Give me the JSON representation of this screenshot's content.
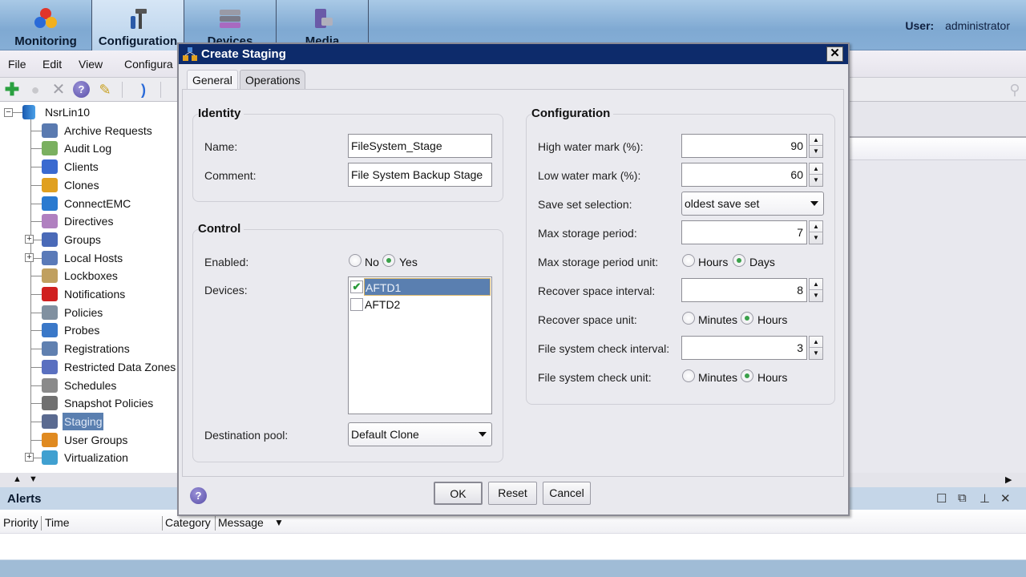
{
  "nav": {
    "tabs": [
      {
        "label": "Monitoring",
        "icon": "monitoring-icon",
        "active": false
      },
      {
        "label": "Configuration",
        "icon": "configuration-icon",
        "active": true
      },
      {
        "label": "Devices",
        "icon": "devices-icon",
        "active": false
      },
      {
        "label": "Media",
        "icon": "media-icon",
        "active": false
      }
    ],
    "user_label": "User:",
    "user_name": "administrator"
  },
  "menubar": [
    "File",
    "Edit",
    "View",
    "Configura"
  ],
  "toolbar": [
    "add-icon",
    "properties-icon",
    "delete-icon",
    "help-icon",
    "wizard-icon",
    "refresh-icon"
  ],
  "tree": {
    "root": "NsrLin10",
    "items": [
      {
        "label": "Archive Requests",
        "icon": "archive-requests-icon",
        "expandable": false
      },
      {
        "label": "Audit Log",
        "icon": "audit-log-icon",
        "expandable": false
      },
      {
        "label": "Clients",
        "icon": "clients-icon",
        "expandable": false
      },
      {
        "label": "Clones",
        "icon": "clones-icon",
        "expandable": false
      },
      {
        "label": "ConnectEMC",
        "icon": "connectemc-icon",
        "expandable": false
      },
      {
        "label": "Directives",
        "icon": "directives-icon",
        "expandable": false
      },
      {
        "label": "Groups",
        "icon": "groups-icon",
        "expandable": true
      },
      {
        "label": "Local Hosts",
        "icon": "local-hosts-icon",
        "expandable": true
      },
      {
        "label": "Lockboxes",
        "icon": "lockboxes-icon",
        "expandable": false
      },
      {
        "label": "Notifications",
        "icon": "notifications-icon",
        "expandable": false
      },
      {
        "label": "Policies",
        "icon": "policies-icon",
        "expandable": false
      },
      {
        "label": "Probes",
        "icon": "probes-icon",
        "expandable": false
      },
      {
        "label": "Registrations",
        "icon": "registrations-icon",
        "expandable": false
      },
      {
        "label": "Restricted Data Zones",
        "icon": "restricted-data-zones-icon",
        "expandable": false
      },
      {
        "label": "Schedules",
        "icon": "schedules-icon",
        "expandable": false
      },
      {
        "label": "Snapshot Policies",
        "icon": "snapshot-policies-icon",
        "expandable": false
      },
      {
        "label": "Staging",
        "icon": "staging-icon",
        "expandable": false,
        "selected": true
      },
      {
        "label": "User Groups",
        "icon": "user-groups-icon",
        "expandable": false
      },
      {
        "label": "Virtualization",
        "icon": "virtualization-icon",
        "expandable": true
      }
    ]
  },
  "alerts": {
    "title": "Alerts",
    "columns": [
      "Priority",
      "Time",
      "Category",
      "Message"
    ]
  },
  "dialog": {
    "title": "Create Staging",
    "tabs": [
      "General",
      "Operations"
    ],
    "active_tab": "General",
    "identity": {
      "title": "Identity",
      "name_label": "Name:",
      "name_value": "FileSystem_Stage",
      "comment_label": "Comment:",
      "comment_value": "File System Backup Stage"
    },
    "control": {
      "title": "Control",
      "enabled_label": "Enabled:",
      "enabled_options": [
        "No",
        "Yes"
      ],
      "enabled_value": "Yes",
      "devices_label": "Devices:",
      "devices": [
        {
          "name": "AFTD1",
          "checked": true,
          "selected": true
        },
        {
          "name": "AFTD2",
          "checked": false,
          "selected": false
        }
      ],
      "destination_pool_label": "Destination pool:",
      "destination_pool_value": "Default Clone"
    },
    "configuration": {
      "title": "Configuration",
      "high_water_label": "High water mark (%):",
      "high_water_value": "90",
      "low_water_label": "Low water mark (%):",
      "low_water_value": "60",
      "save_set_label": "Save set selection:",
      "save_set_value": "oldest save set",
      "max_storage_label": "Max storage period:",
      "max_storage_value": "7",
      "max_storage_unit_label": "Max storage period unit:",
      "max_storage_unit_options": [
        "Hours",
        "Days"
      ],
      "max_storage_unit_value": "Days",
      "recover_interval_label": "Recover space interval:",
      "recover_interval_value": "8",
      "recover_unit_label": "Recover space unit:",
      "recover_unit_options": [
        "Minutes",
        "Hours"
      ],
      "recover_unit_value": "Hours",
      "fs_check_interval_label": "File system check interval:",
      "fs_check_interval_value": "3",
      "fs_check_unit_label": "File system check unit:",
      "fs_check_unit_options": [
        "Minutes",
        "Hours"
      ],
      "fs_check_unit_value": "Hours"
    },
    "buttons": {
      "ok": "OK",
      "reset": "Reset",
      "cancel": "Cancel",
      "help": "?"
    }
  }
}
